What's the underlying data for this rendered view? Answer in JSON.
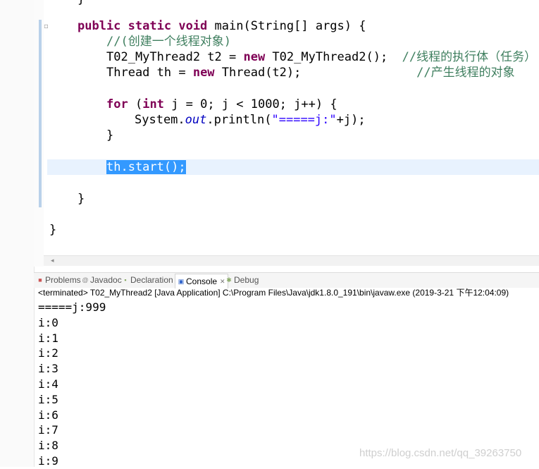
{
  "editor": {
    "closing_brace_top": "}",
    "line_main": {
      "kw1": "public",
      "kw2": "static",
      "kw3": "void",
      "rest": " main(String[] args) {"
    },
    "line_comment1": "//(创建一个线程对象)",
    "line_t2": {
      "pre": "T02_MyThread2 t2 = ",
      "kw": "new",
      "mid": " T02_MyThread2();  ",
      "cm": "//线程的执行体（任务）"
    },
    "line_th": {
      "pre": "Thread th = ",
      "kw": "new",
      "mid": " Thread(t2);                ",
      "cm": "//产生线程的对象"
    },
    "line_for": {
      "kw1": "for",
      "p1": " (",
      "kw2": "int",
      "p2": " j = 0; j < 1000; j++) {"
    },
    "line_print": {
      "pre": "System.",
      "fld": "out",
      "mid": ".println(",
      "str": "\"=====j:\"",
      "post": "+j);"
    },
    "line_close_for": "}",
    "line_start": "th.start();",
    "line_close_main": "}",
    "line_close_class": "}"
  },
  "tabs": [
    {
      "label": "Problems",
      "icon": "problems-icon"
    },
    {
      "label": "Javadoc",
      "icon": "javadoc-icon"
    },
    {
      "label": "Declaration",
      "icon": "declaration-icon"
    },
    {
      "label": "Console",
      "icon": "console-icon"
    },
    {
      "label": "Debug",
      "icon": "debug-icon"
    }
  ],
  "console": {
    "status": "<terminated> T02_MyThread2 [Java Application] C:\\Program Files\\Java\\jdk1.8.0_191\\bin\\javaw.exe (2019-3-21 下午12:04:09)",
    "lines": [
      "=====j:999",
      "i:0",
      "i:1",
      "i:2",
      "i:3",
      "i:4",
      "i:5",
      "i:6",
      "i:7",
      "i:8",
      "i:9"
    ]
  },
  "watermark": "https://blog.csdn.net/qq_39263750"
}
